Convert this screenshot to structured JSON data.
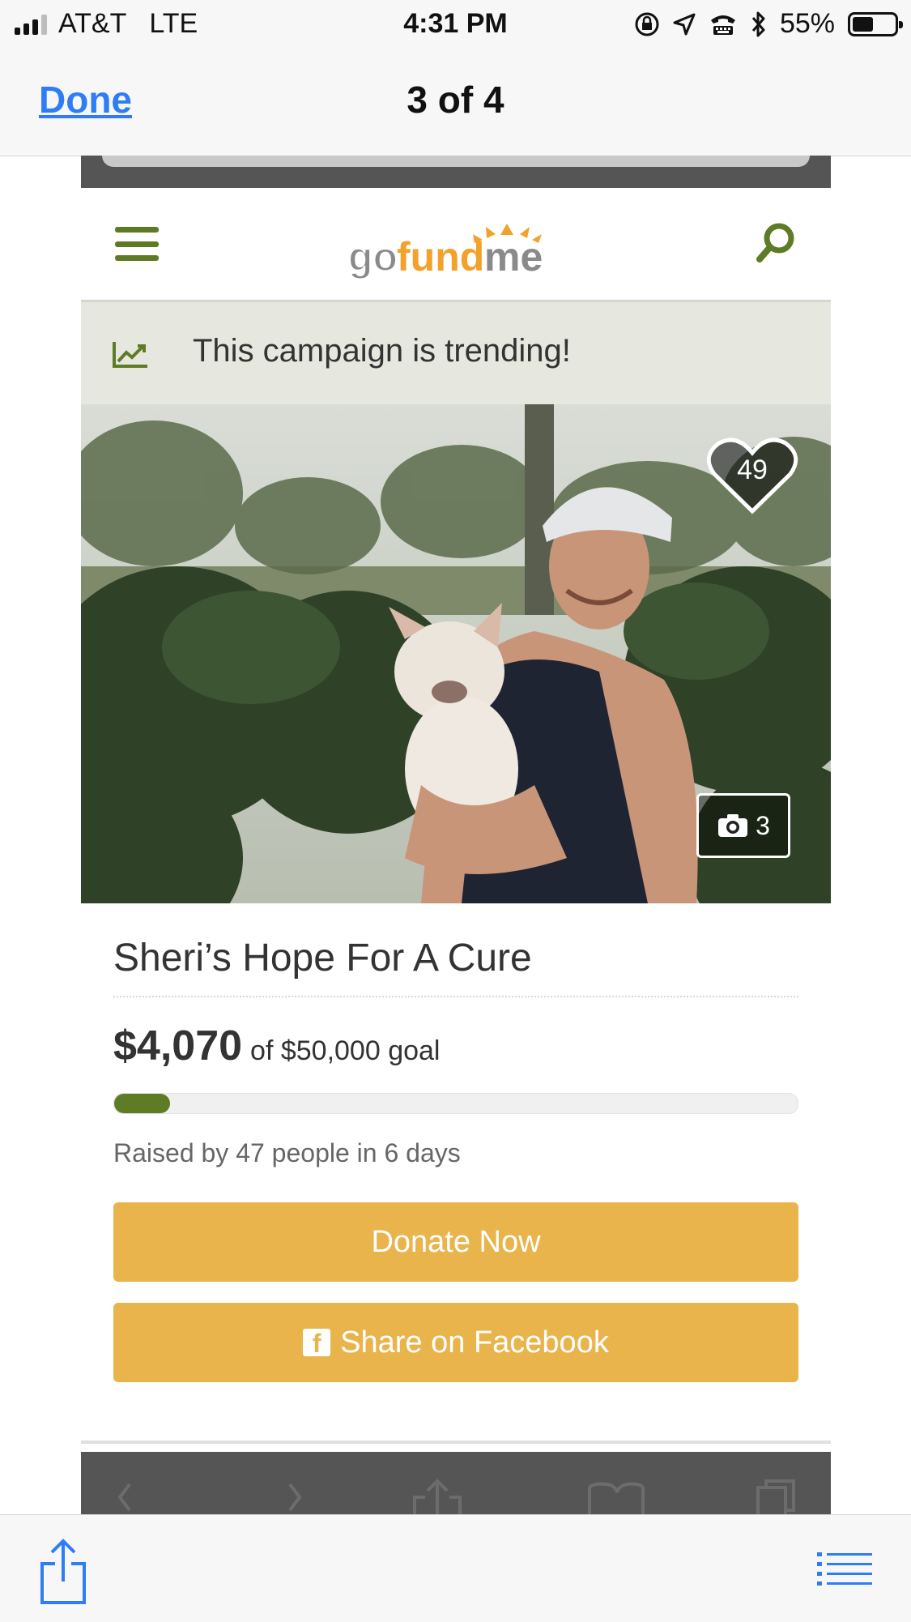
{
  "status_bar": {
    "carrier": "AT&T",
    "network": "LTE",
    "time": "4:31 PM",
    "battery_percent": "55%",
    "battery_level": 0.55,
    "icons": [
      "signal-icon",
      "rotation-lock-icon",
      "location-icon",
      "tty-icon",
      "bluetooth-icon",
      "battery-icon"
    ]
  },
  "nav": {
    "done_label": "Done",
    "title": "3 of 4"
  },
  "site": {
    "logo_text": "gofundme",
    "trending_text": "This campaign is trending!"
  },
  "campaign": {
    "likes": "49",
    "photo_count": "3",
    "title": "Sheri’s Hope For A Cure",
    "raised_amount": "$4,070",
    "goal_text": "of $50,000 goal",
    "progress_fraction": 0.0814,
    "raised_by_text": "Raised by 47 people in 6 days",
    "donate_label": "Donate Now",
    "share_label": "Share on Facebook",
    "fb_glyph": "f"
  },
  "colors": {
    "brand_green": "#5e7b25",
    "button_yellow": "#e9b44c",
    "ios_blue": "#2f7df6",
    "trending_bg": "#e6e8e0"
  }
}
